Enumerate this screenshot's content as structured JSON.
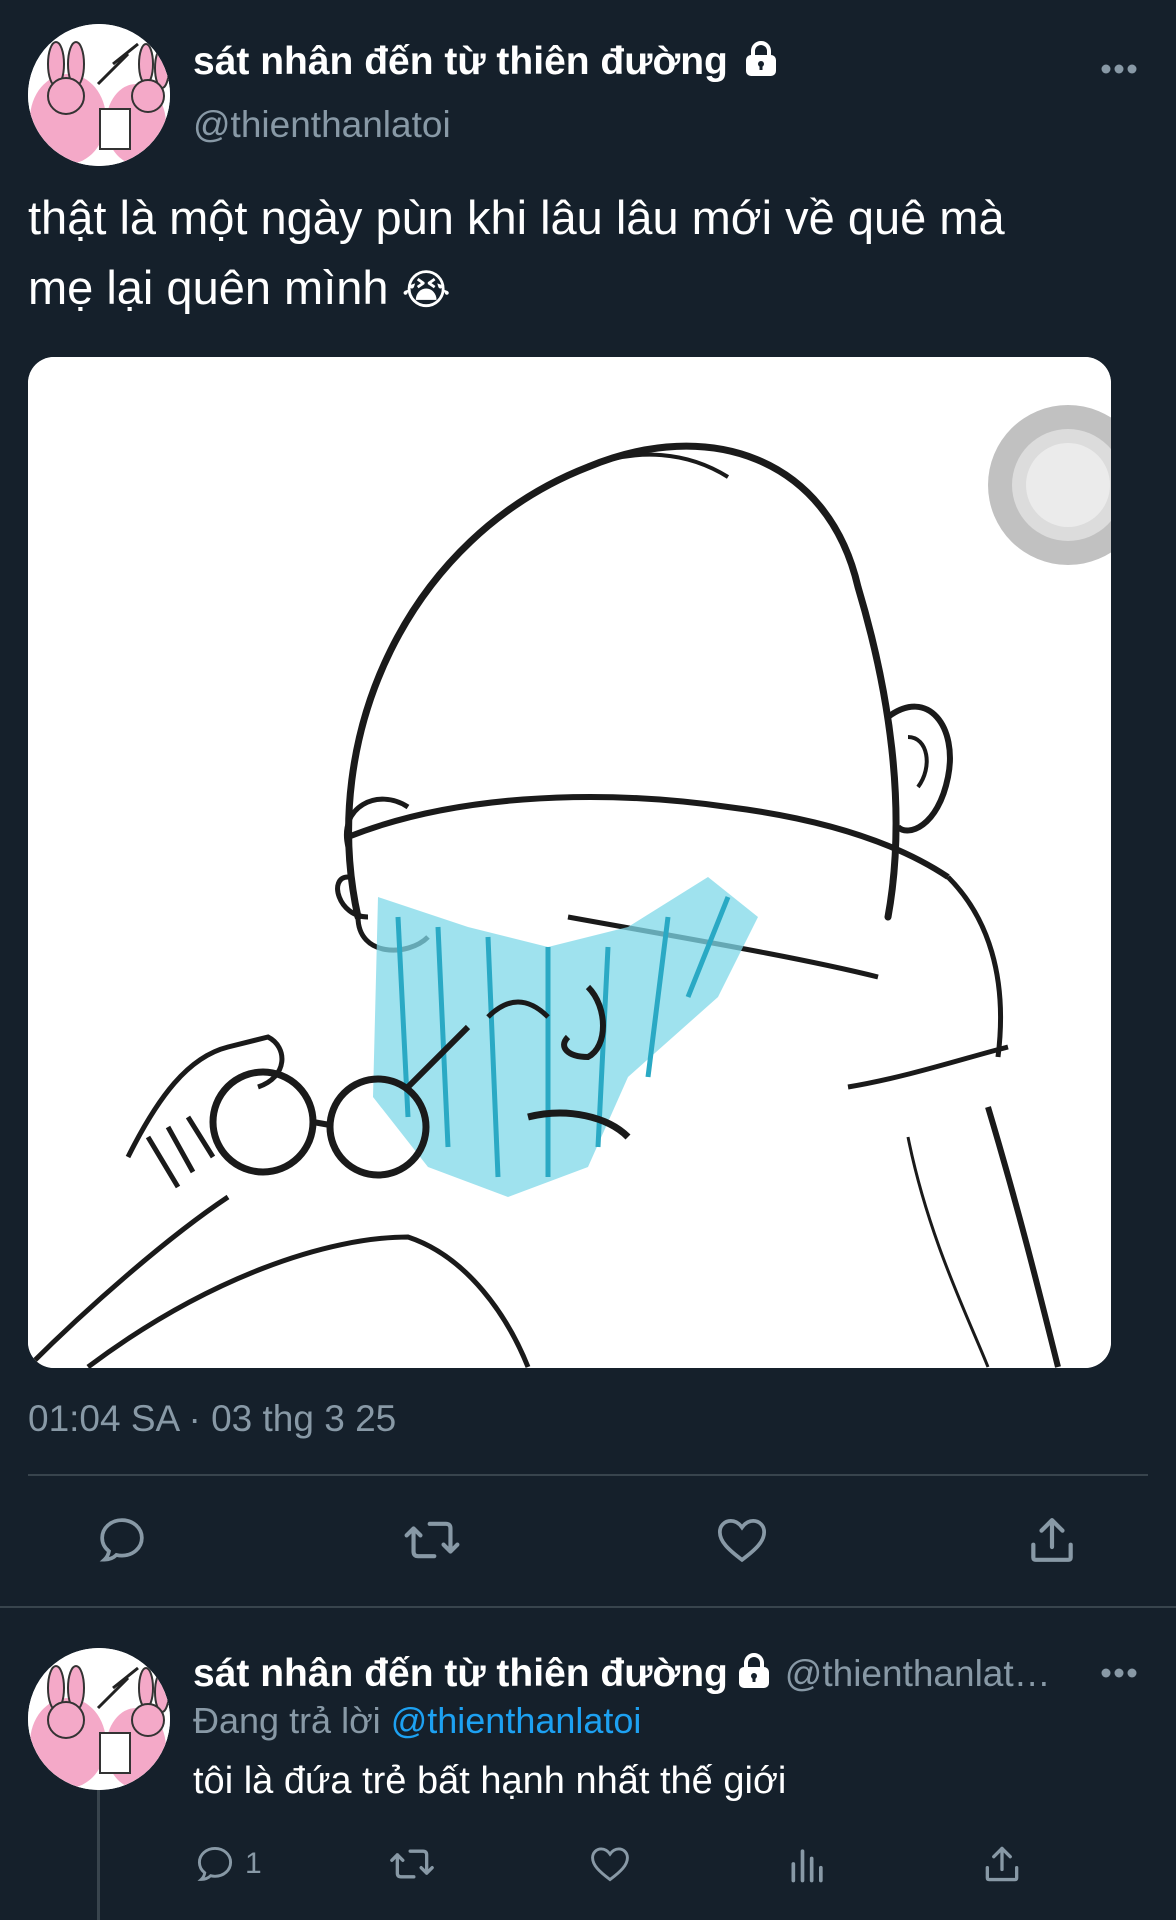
{
  "main_tweet": {
    "display_name": "sát nhân đến từ thiên đường",
    "handle": "@thienthanlatoi",
    "text_line1": "thật là một ngày pùn khi lâu lâu mới về quê mà",
    "text_line2": "mẹ lại quên mình",
    "emoji": "😭",
    "timestamp": "01:04 SA · 03 thg 3 25"
  },
  "reply_tweet": {
    "display_name": "sát nhân đến từ thiên đường",
    "handle": "@thienthanlat…",
    "replying_prefix": "Đang trả lời",
    "replying_to": "@thienthanlatoi",
    "text": "tôi là đứa trẻ bất hạnh nhất thế giới",
    "reply_count": "1"
  },
  "icons": {
    "more": "more-dots-icon",
    "lock": "lock-icon",
    "reply": "reply-icon",
    "retweet": "retweet-icon",
    "like": "heart-icon",
    "share": "share-icon",
    "analytics": "analytics-icon"
  },
  "colors": {
    "background": "#15202b",
    "secondary_text": "#8899a6",
    "accent": "#1da1f2",
    "divider": "#38444d"
  }
}
